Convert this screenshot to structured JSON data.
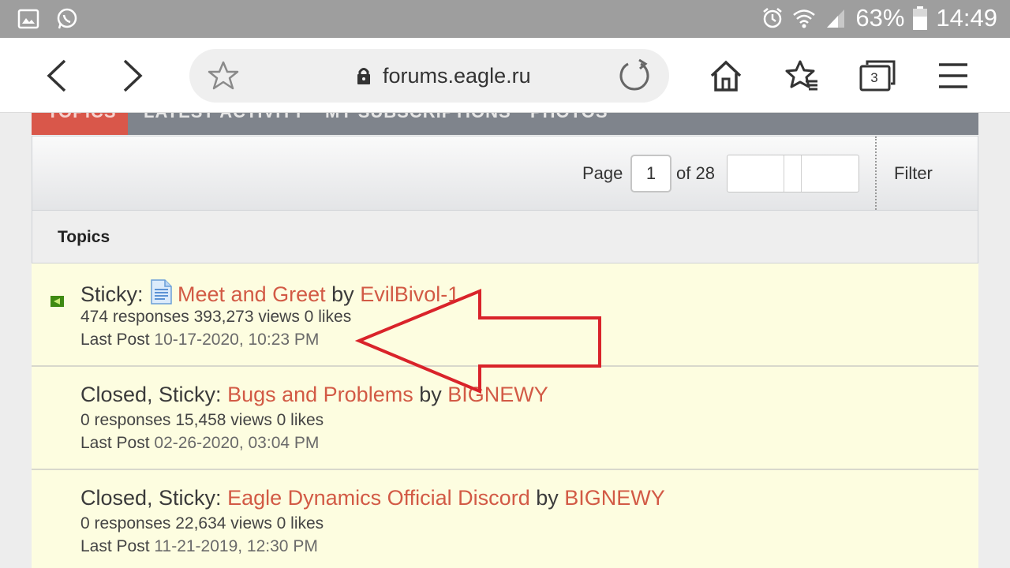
{
  "status_bar": {
    "battery": "63%",
    "time": "14:49",
    "left_icons": [
      "gallery-icon",
      "whatsapp-icon"
    ],
    "right_icons": [
      "alarm-icon",
      "wifi-icon",
      "signal-icon",
      "battery-icon"
    ]
  },
  "browser": {
    "url": "forums.eagle.ru",
    "tab_count": "3"
  },
  "forum_tabs": [
    "TOPICS",
    "LATEST ACTIVITY",
    "MY SUBSCRIPTIONS",
    "PHOTOS"
  ],
  "pagination": {
    "page_label": "Page",
    "current_page": "1",
    "of_label": "of 28",
    "filter_label": "Filter"
  },
  "topics_header": "Topics",
  "topics": [
    {
      "prefix": "Sticky:",
      "title": "Meet and Greet",
      "by": "by",
      "author": "EvilBivol-1",
      "stats": "474 responses 393,273 views 0 likes",
      "last_post_label": "Last Post",
      "last_post_date": "10-17-2020, 10:23 PM"
    },
    {
      "prefix": "Closed, Sticky:",
      "title": "Bugs and Problems",
      "by": "by",
      "author": "BIGNEWY",
      "stats": "0 responses 15,458 views 0 likes",
      "last_post_label": "Last Post",
      "last_post_date": "02-26-2020, 03:04 PM"
    },
    {
      "prefix": "Closed, Sticky:",
      "title": "Eagle Dynamics Official Discord",
      "by": "by",
      "author": "BIGNEWY",
      "stats": "0 responses 22,634 views 0 likes",
      "last_post_label": "Last Post",
      "last_post_date": "11-21-2019, 12:30 PM"
    }
  ],
  "colors": {
    "accent": "#d25a45",
    "row_bg": "#fdfde0",
    "annotation_arrow": "#d9232a"
  }
}
